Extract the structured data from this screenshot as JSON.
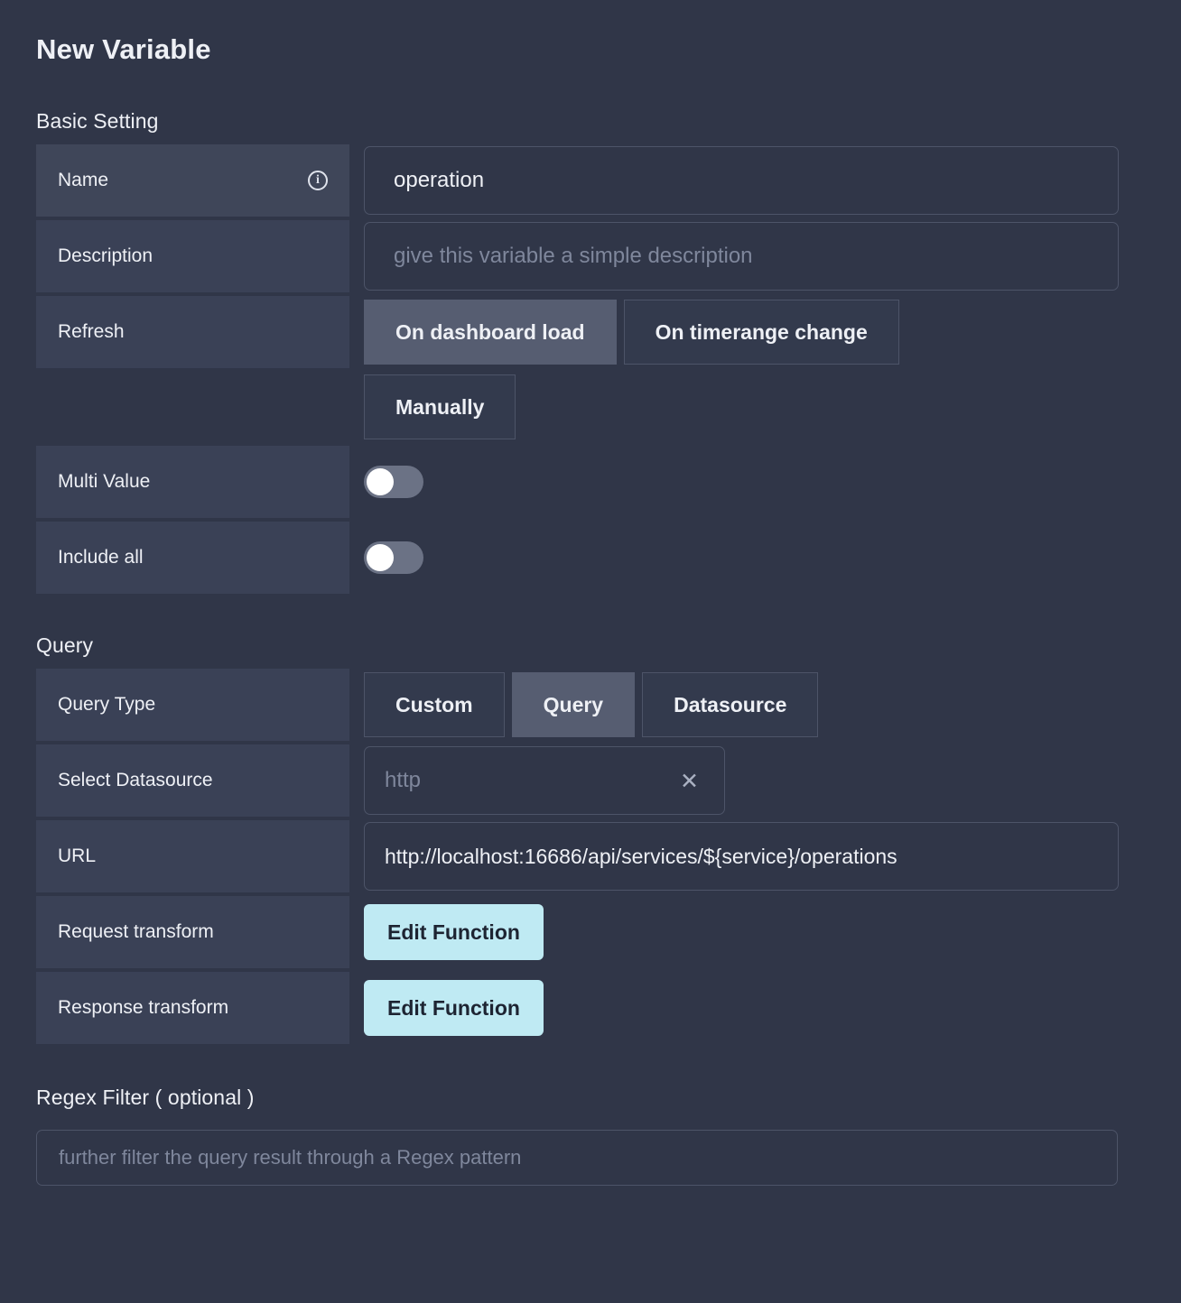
{
  "page": {
    "title": "New Variable"
  },
  "basic": {
    "section_title": "Basic Setting",
    "name": {
      "label": "Name",
      "info_icon": "info-icon",
      "value": "operation",
      "placeholder": ""
    },
    "description": {
      "label": "Description",
      "value": "",
      "placeholder": "give this variable a simple description"
    },
    "refresh": {
      "label": "Refresh",
      "options": [
        {
          "label": "On dashboard load",
          "selected": true
        },
        {
          "label": "On timerange change",
          "selected": false
        },
        {
          "label": "Manually",
          "selected": false
        }
      ]
    },
    "multi_value": {
      "label": "Multi Value",
      "enabled": false
    },
    "include_all": {
      "label": "Include all",
      "enabled": false
    }
  },
  "query": {
    "section_title": "Query",
    "query_type": {
      "label": "Query Type",
      "options": [
        {
          "label": "Custom",
          "selected": false
        },
        {
          "label": "Query",
          "selected": true
        },
        {
          "label": "Datasource",
          "selected": false
        }
      ]
    },
    "select_datasource": {
      "label": "Select Datasource",
      "value": "http",
      "clear_icon": "close-icon"
    },
    "url": {
      "label": "URL",
      "value": "http://localhost:16686/api/services/${service}/operations",
      "placeholder": ""
    },
    "request_transform": {
      "label": "Request transform",
      "button_label": "Edit Function"
    },
    "response_transform": {
      "label": "Response transform",
      "button_label": "Edit Function"
    }
  },
  "regex": {
    "section_title": "Regex Filter ( optional )",
    "value": "",
    "placeholder": "further filter the query result through a Regex pattern"
  },
  "colors": {
    "page_background": "#303648",
    "row_background": "#3a4156",
    "input_border": "#4d5468",
    "accent": "#bfeaf3",
    "accent_text": "#1d2432",
    "muted_text": "#7f879c",
    "selected_button": "#565d71"
  }
}
